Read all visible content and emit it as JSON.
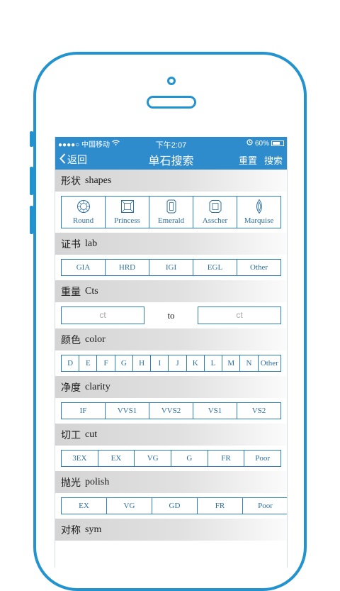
{
  "status": {
    "carrier": "●●●●○ 中国移动",
    "time": "下午2:07",
    "battery": "60%"
  },
  "nav": {
    "back": "返回",
    "title": "单石搜索",
    "reset": "重置",
    "search": "搜索"
  },
  "sections": {
    "shapes": {
      "cn": "形状",
      "en": "shapes",
      "items": [
        "Round",
        "Princess",
        "Emerald",
        "Asscher",
        "Marquise"
      ]
    },
    "lab": {
      "cn": "证书",
      "en": "lab",
      "items": [
        "GIA",
        "HRD",
        "IGI",
        "EGL",
        "Other"
      ]
    },
    "cts": {
      "cn": "重量",
      "en": "Cts",
      "from_placeholder": "ct",
      "to_label": "to",
      "to_placeholder": "ct"
    },
    "color": {
      "cn": "颜色",
      "en": "color",
      "items": [
        "D",
        "E",
        "F",
        "G",
        "H",
        "I",
        "J",
        "K",
        "L",
        "M",
        "N",
        "Other"
      ]
    },
    "clarity": {
      "cn": "净度",
      "en": "clarity",
      "items": [
        "IF",
        "VVS1",
        "VVS2",
        "VS1",
        "VS2"
      ]
    },
    "cut": {
      "cn": "切工",
      "en": "cut",
      "items": [
        "3EX",
        "EX",
        "VG",
        "G",
        "FR",
        "Poor"
      ]
    },
    "polish": {
      "cn": "抛光",
      "en": "polish",
      "items": [
        "EX",
        "VG",
        "GD",
        "FR",
        "Poor"
      ]
    },
    "sym": {
      "cn": "对称",
      "en": "sym"
    }
  },
  "colors": {
    "primary": "#2f8ccc",
    "outline": "#2393cf",
    "option_text": "#2d6f9e"
  }
}
